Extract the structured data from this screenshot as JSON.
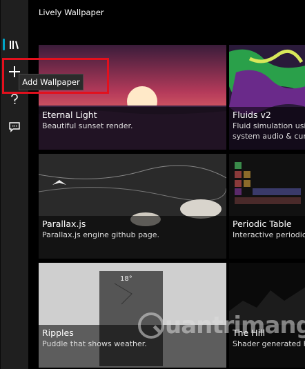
{
  "app": {
    "title": "Lively Wallpaper"
  },
  "sidebar": {
    "items": [
      {
        "name": "library-icon",
        "selected": true
      },
      {
        "name": "add-icon",
        "tooltip": "Add Wallpaper"
      },
      {
        "name": "help-icon"
      },
      {
        "name": "feedback-icon"
      }
    ]
  },
  "tooltip": {
    "text": "Add Wallpaper"
  },
  "wallpapers": [
    {
      "title": "Eternal Light",
      "desc": "Beautiful sunset render.",
      "selected": true
    },
    {
      "title": "Fluids v2",
      "desc": "Fluid simulation usi",
      "desc2": "system audio & cur"
    },
    {
      "title": "Parallax.js",
      "desc": "Parallax.js engine github page."
    },
    {
      "title": "Periodic Table",
      "desc": "Interactive periodic"
    },
    {
      "title": "Ripples",
      "desc": "Puddle that shows weather."
    },
    {
      "title": "The Hill",
      "desc": "Shader generated hi"
    }
  ],
  "weather_card": {
    "temp": "18°"
  },
  "watermark": {
    "text": "uantrimang"
  },
  "colors": {
    "accent": "#19a9c4",
    "highlight": "#e3101d",
    "sidebar": "#1f1f1f"
  }
}
